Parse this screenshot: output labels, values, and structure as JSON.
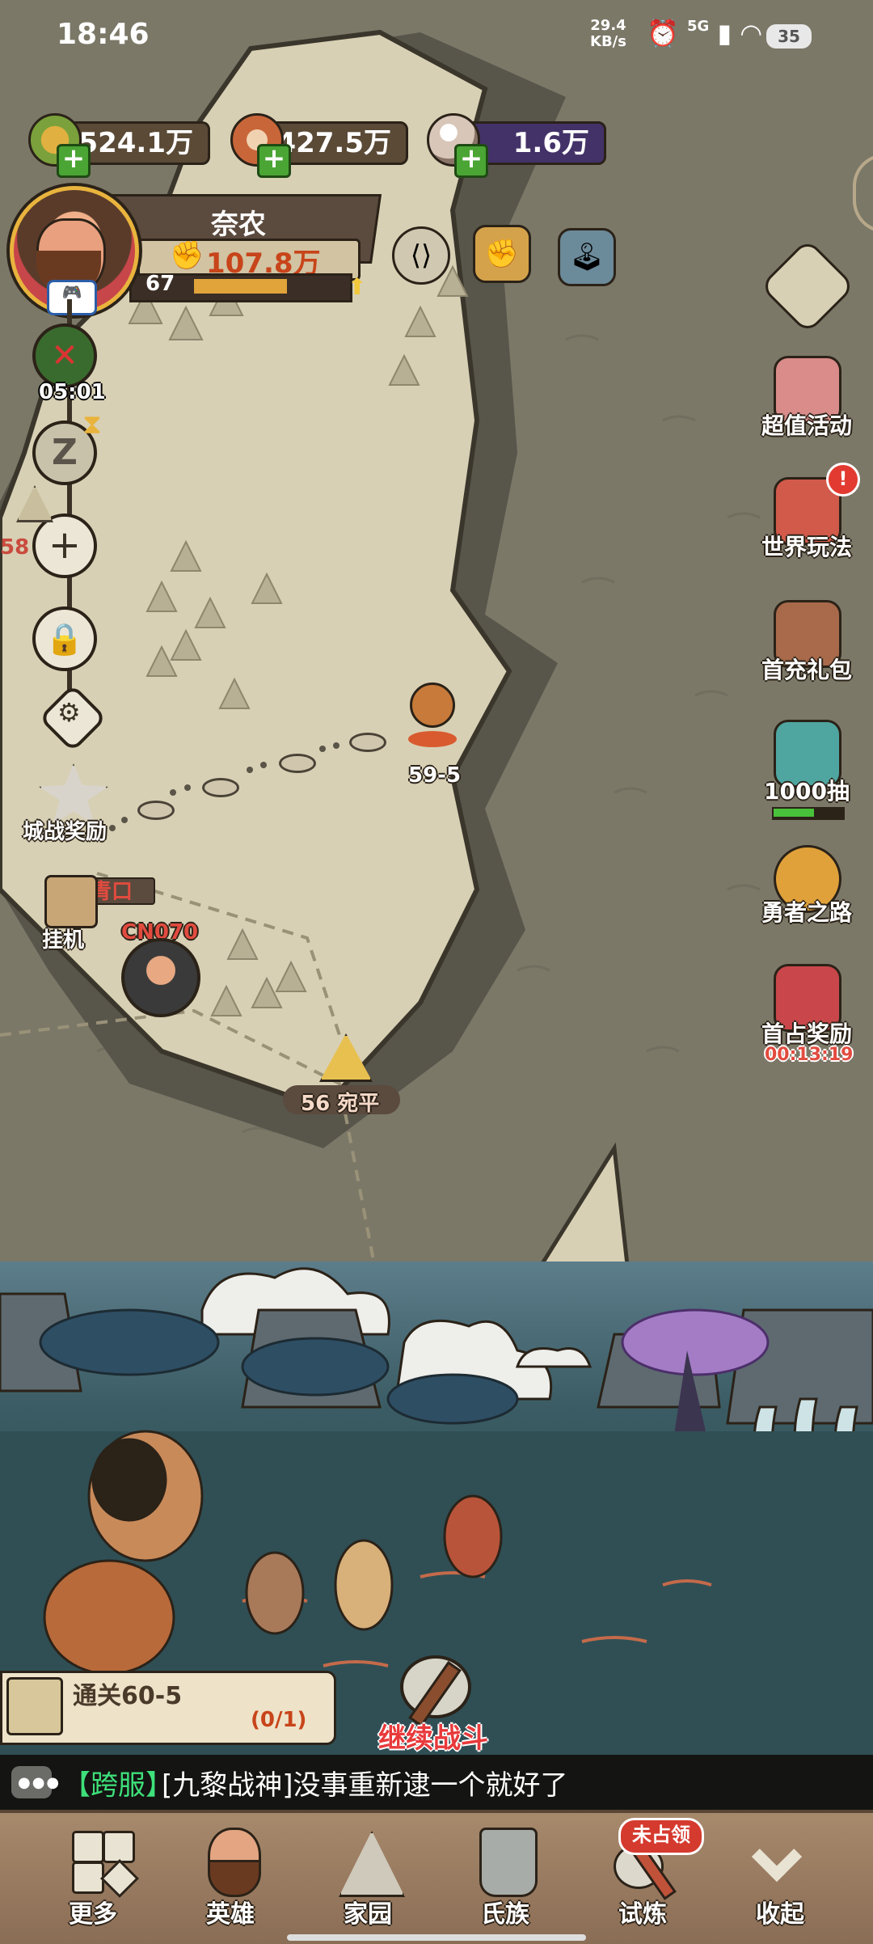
{
  "status_bar": {
    "time": "18:46",
    "net_speed": "29.4",
    "net_unit": "KB/s",
    "network": "5G",
    "battery": "35"
  },
  "resources": [
    {
      "name": "grain",
      "value": "524.1万",
      "color": "#5a4a36"
    },
    {
      "name": "meat",
      "value": "427.5万",
      "color": "#5a4a36"
    },
    {
      "name": "pearl",
      "value": "1.6万",
      "color": "#433268"
    }
  ],
  "profile": {
    "name": "奈农",
    "power": "107.8万",
    "level": "67",
    "level_progress": 0.62
  },
  "left_buttons": {
    "timer": "05:01"
  },
  "map": {
    "current_stage": "59-5",
    "side_count": "58",
    "city_battle_reward": "城战奖励",
    "idle": "挂机",
    "pass_name": "青口",
    "enemy_tag": "CN070",
    "city_label": "56 宛平"
  },
  "right_menu": [
    {
      "label": "超值活动",
      "icon": "treasure-chest-icon"
    },
    {
      "label": "世界玩法",
      "icon": "hammer-icon"
    },
    {
      "label": "首充礼包",
      "icon": "warrior-gift-icon"
    },
    {
      "label": "1000抽",
      "icon": "totem-icon"
    },
    {
      "label": "勇者之路",
      "icon": "shield-medal-icon"
    },
    {
      "label": "首占奖励",
      "icon": "book-reward-icon",
      "timer": "00:13:19"
    }
  ],
  "quest": {
    "title": "通关60-5",
    "progress": "(0/1)"
  },
  "continue_battle": "继续战斗",
  "chat": {
    "tag": "【跨服】",
    "message": "[九黎战神]没事重新逮一个就好了"
  },
  "bottom_nav": [
    {
      "label": "更多",
      "icon": "more-icon"
    },
    {
      "label": "英雄",
      "icon": "hero-icon"
    },
    {
      "label": "家园",
      "icon": "home-icon"
    },
    {
      "label": "氏族",
      "icon": "clan-icon"
    },
    {
      "label": "试炼",
      "icon": "trial-icon",
      "badge": "未占领"
    },
    {
      "label": "收起",
      "icon": "collapse-icon"
    }
  ]
}
